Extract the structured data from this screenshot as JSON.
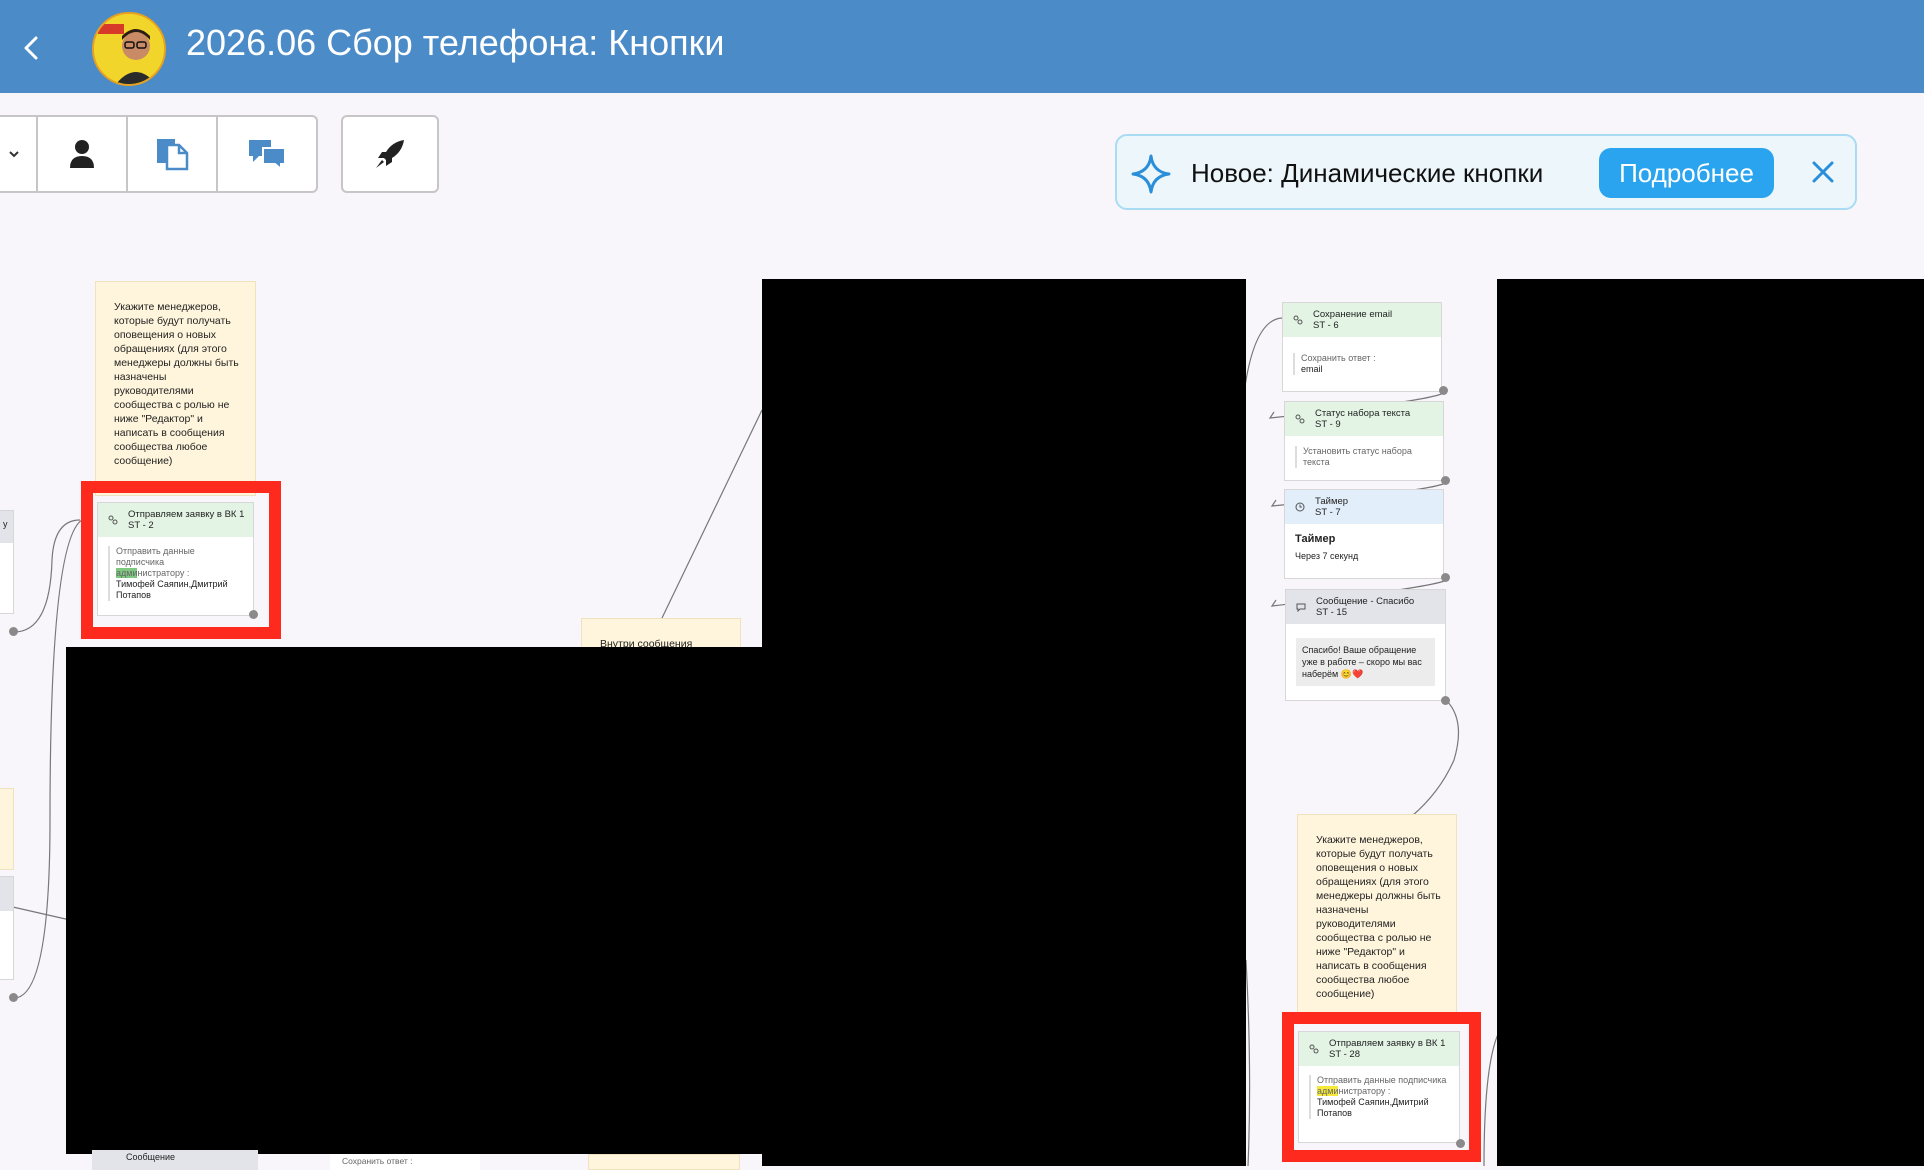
{
  "header": {
    "title": "2026.06 Сбор телефона: Кнопки",
    "bg_color": "#4a8bc8"
  },
  "toolbar": {
    "icons": [
      "chevron-down-icon",
      "user-icon",
      "document-icon",
      "chat-icon",
      "rocket-icon"
    ]
  },
  "banner": {
    "text": "Новое: Динамические кнопки",
    "button_label": "Подробнее",
    "accent": "#2aa4ee"
  },
  "notes": {
    "managers_left": "Укажите менеджеров, которые будут получать оповещения о новых обращениях (для этого менеджеры должны быть назначены руководителями сообщества с ролью не ниже \"Редактор\" и написать в сообщения сообщества любое сообщение)",
    "managers_right": "Укажите менеджеров, которые будут получать оповещения о новых обращениях (для этого менеджеры должны быть назначены руководителями сообщества с ролью не ниже \"Редактор\" и написать в сообщения сообщества любое сообщение)",
    "inside_message": "Внутри сообщения"
  },
  "nodes": {
    "vk_left": {
      "title": "Отправляем заявку в ВК 1",
      "code": "ST - 2",
      "line1": "Отправить данные подписчика",
      "admin_hl": "адми",
      "admin_rest": "нистратору :",
      "names": "Тимофей Саяпин,Дмитрий Потапов"
    },
    "save_email": {
      "title": "Сохранение email",
      "code": "ST - 6",
      "label": "Сохранить ответ :",
      "value": "email"
    },
    "typing": {
      "title": "Статус набора текста",
      "code": "ST - 9",
      "body": "Установить статус набора текста"
    },
    "timer": {
      "title": "Таймер",
      "code": "ST - 7",
      "heading": "Таймер",
      "body": "Через 7 секунд"
    },
    "thanks": {
      "title": "Сообщение - Спасибо",
      "code": "ST - 15",
      "body": "Спасибо! Ваше обращение уже в работе – скоро мы вас наберём 😊❤️"
    },
    "vk_right": {
      "title": "Отправляем заявку в ВК 1",
      "code": "ST - 28",
      "line1": "Отправить данные подписчика",
      "admin_hl": "адми",
      "admin_rest": "нистратору :",
      "names": "Тимофей Саяпин,Дмитрий Потапов"
    },
    "bottom_msg": {
      "title": "Сообщение"
    },
    "bottom_save": {
      "label": "Сохранить ответ :"
    },
    "edge_left_fragment": "у"
  },
  "colors": {
    "highlight_red": "#ff2a1e",
    "note_bg": "#fff5dc",
    "green_header": "#e3f4e5"
  }
}
